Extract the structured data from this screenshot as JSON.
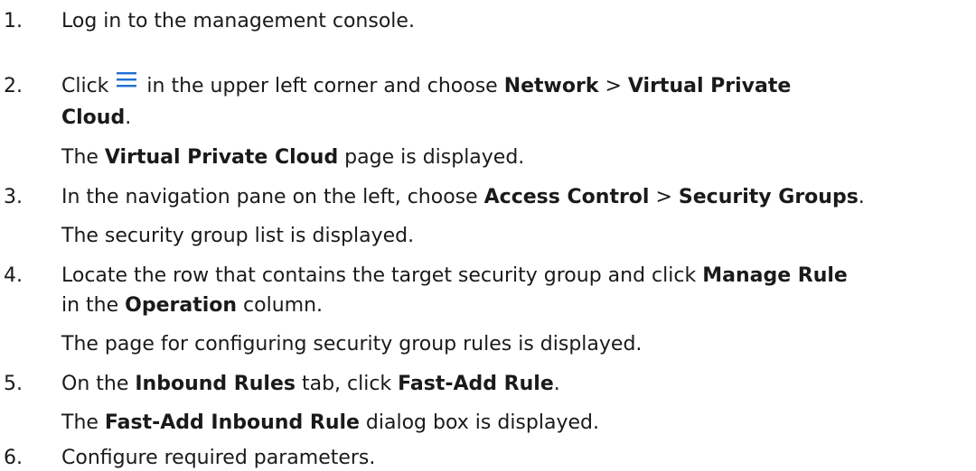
{
  "steps": [
    {
      "num": "1.",
      "text": "Log in to the management console."
    },
    {
      "num": "2.",
      "line1": {
        "a": "Click ",
        "icon": "menu-icon",
        "b": " in the upper left corner and choose ",
        "c": "Network",
        "d": " > ",
        "e": "Virtual Private"
      },
      "line2": {
        "a": "Cloud",
        "b": "."
      },
      "result": {
        "a": "The ",
        "b": "Virtual Private Cloud",
        "c": " page is displayed."
      }
    },
    {
      "num": "3.",
      "line1": {
        "a": "In the navigation pane on the left, choose ",
        "b": "Access Control",
        "c": " > ",
        "d": "Security Groups",
        "e": "."
      },
      "result": "The security group list is displayed."
    },
    {
      "num": "4.",
      "line1": {
        "a": "Locate the row that contains the target security group and click ",
        "b": "Manage Rule"
      },
      "line2": {
        "a": "in the ",
        "b": "Operation",
        "c": " column."
      },
      "result": "The page for configuring security group rules is displayed."
    },
    {
      "num": "5.",
      "line1": {
        "a": "On the ",
        "b": "Inbound Rules",
        "c": " tab, click ",
        "d": "Fast-Add Rule",
        "e": "."
      },
      "result": {
        "a": "The ",
        "b": "Fast-Add Inbound Rule",
        "c": " dialog box is displayed."
      }
    },
    {
      "num": "6.",
      "text": "Configure required parameters."
    }
  ]
}
